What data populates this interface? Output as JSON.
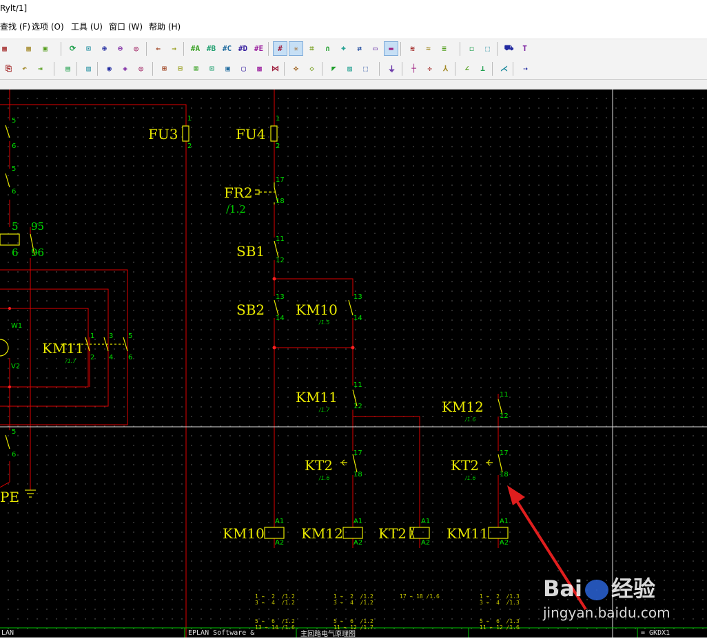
{
  "window": {
    "title": "Rylt/1]"
  },
  "menu": [
    {
      "label": "查找 (F)"
    },
    {
      "label": "选项 (O)"
    },
    {
      "label": "工具 (U)"
    },
    {
      "label": "窗口 (W)"
    },
    {
      "label": "帮助 (H)"
    }
  ],
  "toolbar_row1": [
    {
      "icon": "page-icon",
      "glyph": "▦"
    },
    {
      "icon": "grid-icon",
      "glyph": "▦"
    },
    {
      "icon": "monitor-icon",
      "glyph": "▣"
    },
    {
      "icon": "refresh-icon",
      "glyph": "⟳"
    },
    {
      "icon": "zoom-area-icon",
      "glyph": "⊡"
    },
    {
      "icon": "zoom-in-icon",
      "glyph": "⊕"
    },
    {
      "icon": "zoom-out-icon",
      "glyph": "⊖"
    },
    {
      "icon": "zoom-100-icon",
      "glyph": "◎"
    },
    {
      "icon": "arrow-left-icon",
      "glyph": "←"
    },
    {
      "icon": "arrow-right-icon",
      "glyph": "→"
    },
    {
      "icon": "grid-a-icon",
      "glyph": "#A"
    },
    {
      "icon": "grid-b-icon",
      "glyph": "#B"
    },
    {
      "icon": "grid-c-icon",
      "glyph": "#C"
    },
    {
      "icon": "grid-d-icon",
      "glyph": "#D"
    },
    {
      "icon": "grid-e-icon",
      "glyph": "#E"
    },
    {
      "icon": "grid-toggle-icon",
      "glyph": "#"
    },
    {
      "icon": "snap-icon",
      "glyph": "✳"
    },
    {
      "icon": "crosshair-icon",
      "glyph": "⌗"
    },
    {
      "icon": "magnet-icon",
      "glyph": "∩"
    },
    {
      "icon": "connect-icon",
      "glyph": "⌖"
    },
    {
      "icon": "route-icon",
      "glyph": "⇄"
    },
    {
      "icon": "counter-icon",
      "glyph": "▭"
    },
    {
      "icon": "ruler-icon",
      "glyph": "▬"
    },
    {
      "icon": "lines-icon",
      "glyph": "≋"
    },
    {
      "icon": "wave-icon",
      "glyph": "≈"
    },
    {
      "icon": "hatch-icon",
      "glyph": "≡"
    },
    {
      "icon": "frame-icon",
      "glyph": "◻"
    },
    {
      "icon": "select-icon",
      "glyph": "⬚"
    },
    {
      "icon": "cart-icon",
      "glyph": "⛟"
    },
    {
      "icon": "text-icon",
      "glyph": "T"
    }
  ],
  "toolbar_row2": [
    {
      "icon": "new-page-icon",
      "glyph": "⎘"
    },
    {
      "icon": "undo-page-icon",
      "glyph": "↶"
    },
    {
      "icon": "export-icon",
      "glyph": "⇥"
    },
    {
      "icon": "device-icon",
      "glyph": "▤"
    },
    {
      "icon": "macro-icon",
      "glyph": "▥"
    },
    {
      "icon": "motor-icon",
      "glyph": "◉"
    },
    {
      "icon": "terminal-icon",
      "glyph": "◈"
    },
    {
      "icon": "plug-icon",
      "glyph": "◎"
    },
    {
      "icon": "contact-a-icon",
      "glyph": "⊞"
    },
    {
      "icon": "contact-b-icon",
      "glyph": "⊟"
    },
    {
      "icon": "contact-c-icon",
      "glyph": "⊠"
    },
    {
      "icon": "contact-d-icon",
      "glyph": "⊡"
    },
    {
      "icon": "coil-icon",
      "glyph": "▣"
    },
    {
      "icon": "coil-b-icon",
      "glyph": "▢"
    },
    {
      "icon": "coil-c-icon",
      "glyph": "▩"
    },
    {
      "icon": "cable-icon",
      "glyph": "⋈"
    },
    {
      "icon": "shield-line-icon",
      "glyph": "⟡"
    },
    {
      "icon": "wire-icon",
      "glyph": "◇"
    },
    {
      "icon": "bus-icon",
      "glyph": "◤"
    },
    {
      "icon": "hatch2-icon",
      "glyph": "▨"
    },
    {
      "icon": "dashed-box-icon",
      "glyph": "⬚"
    },
    {
      "icon": "ground-icon",
      "glyph": "⏚"
    },
    {
      "icon": "junction-icon",
      "glyph": "┼"
    },
    {
      "icon": "cross-icon",
      "glyph": "✛"
    },
    {
      "icon": "branch-icon",
      "glyph": "⅄"
    },
    {
      "icon": "angle-icon",
      "glyph": "∠"
    },
    {
      "icon": "tee-icon",
      "glyph": "⊥"
    },
    {
      "icon": "break-icon",
      "glyph": "⋌"
    },
    {
      "icon": "dash-line-icon",
      "glyph": "⇢"
    }
  ],
  "labels": {
    "fu3": "FU3",
    "fu4": "FU4",
    "fr2": "FR2",
    "fr2_ref": "/1.2",
    "sb1": "SB1",
    "sb2": "SB2",
    "km10_contact": "KM10",
    "km10_contact_ref": "/1.5",
    "km11_left": "KM11",
    "km11_left_ref": "/1.7",
    "km11_mid": "KM11",
    "km11_mid_ref": "/1.7",
    "km12_right": "KM12",
    "km12_right_ref": "/1.6",
    "kt2_mid": "KT2",
    "kt2_mid_ref": "/1.6",
    "kt2_right": "KT2",
    "kt2_right_ref": "/1.6",
    "coil_km10": "KM10",
    "coil_km12": "KM12",
    "coil_kt2": "KT2",
    "coil_km11": "KM11",
    "pe": "PE",
    "w1": "W1",
    "v2": "V2"
  },
  "pins": {
    "n1a": "1",
    "n2a": "2",
    "n1b": "1",
    "n2b": "2",
    "n17a": "17",
    "n18a": "18",
    "n11a": "11",
    "n12a": "12",
    "n13a": "13",
    "n14a": "14",
    "n13b": "13",
    "n14b": "14",
    "n11b": "11",
    "n12b": "12",
    "n11c": "11",
    "n12c": "12",
    "n17b": "17",
    "n18b": "18",
    "n17c": "17",
    "n18c": "18",
    "a1a": "A1",
    "a2a": "A2",
    "a1b": "A1",
    "a2b": "A2",
    "a1c": "A1",
    "a2c": "A2",
    "a1d": "A1",
    "a2d": "A2",
    "l5a": "5",
    "l6a": "6",
    "l5b": "5",
    "l6b": "6",
    "l5c": "5",
    "l6c": "6",
    "l95": "95",
    "l96": "96",
    "l5d": "5",
    "l6d": "6",
    "k1": "1",
    "k2": "2",
    "k3": "3",
    "k4": "4",
    "k5": "5",
    "k6": "6"
  },
  "contact_mirrors": {
    "km10": [
      "1 ⌁  2  /1.2",
      "3 ⌁  4  /1.2",
      "5 ⌁  6  /1.2",
      "13 ⌁ 14 /1.6"
    ],
    "km12": [
      "1 ⌁  2  /1.2",
      "3 ⌁  4  /1.2",
      "5 ⌁  6  /1.2",
      "11 ⌁ 12 /1.7"
    ],
    "kt2": [
      "17 ⌁ 18 /1.6"
    ],
    "km11": [
      "1 ⌁  2  /1.3",
      "3 ⌁  4  /1.3",
      "5 ⌁  6  /1.3",
      "11 ⌁ 12 /1.6"
    ]
  },
  "footer": {
    "left": "LAN",
    "company": "EPLAN Software &",
    "title": "主回路电气原理图",
    "code": "= GKDX1"
  },
  "watermark": {
    "brand": "Bai",
    "brand2": "经验",
    "url": "jingyan.baidu.com"
  },
  "colors": {
    "wire": "#e00000",
    "component": "#e8e800",
    "pin": "#00e000",
    "background": "#000000",
    "annotation_arrow": "#e01e1e"
  }
}
